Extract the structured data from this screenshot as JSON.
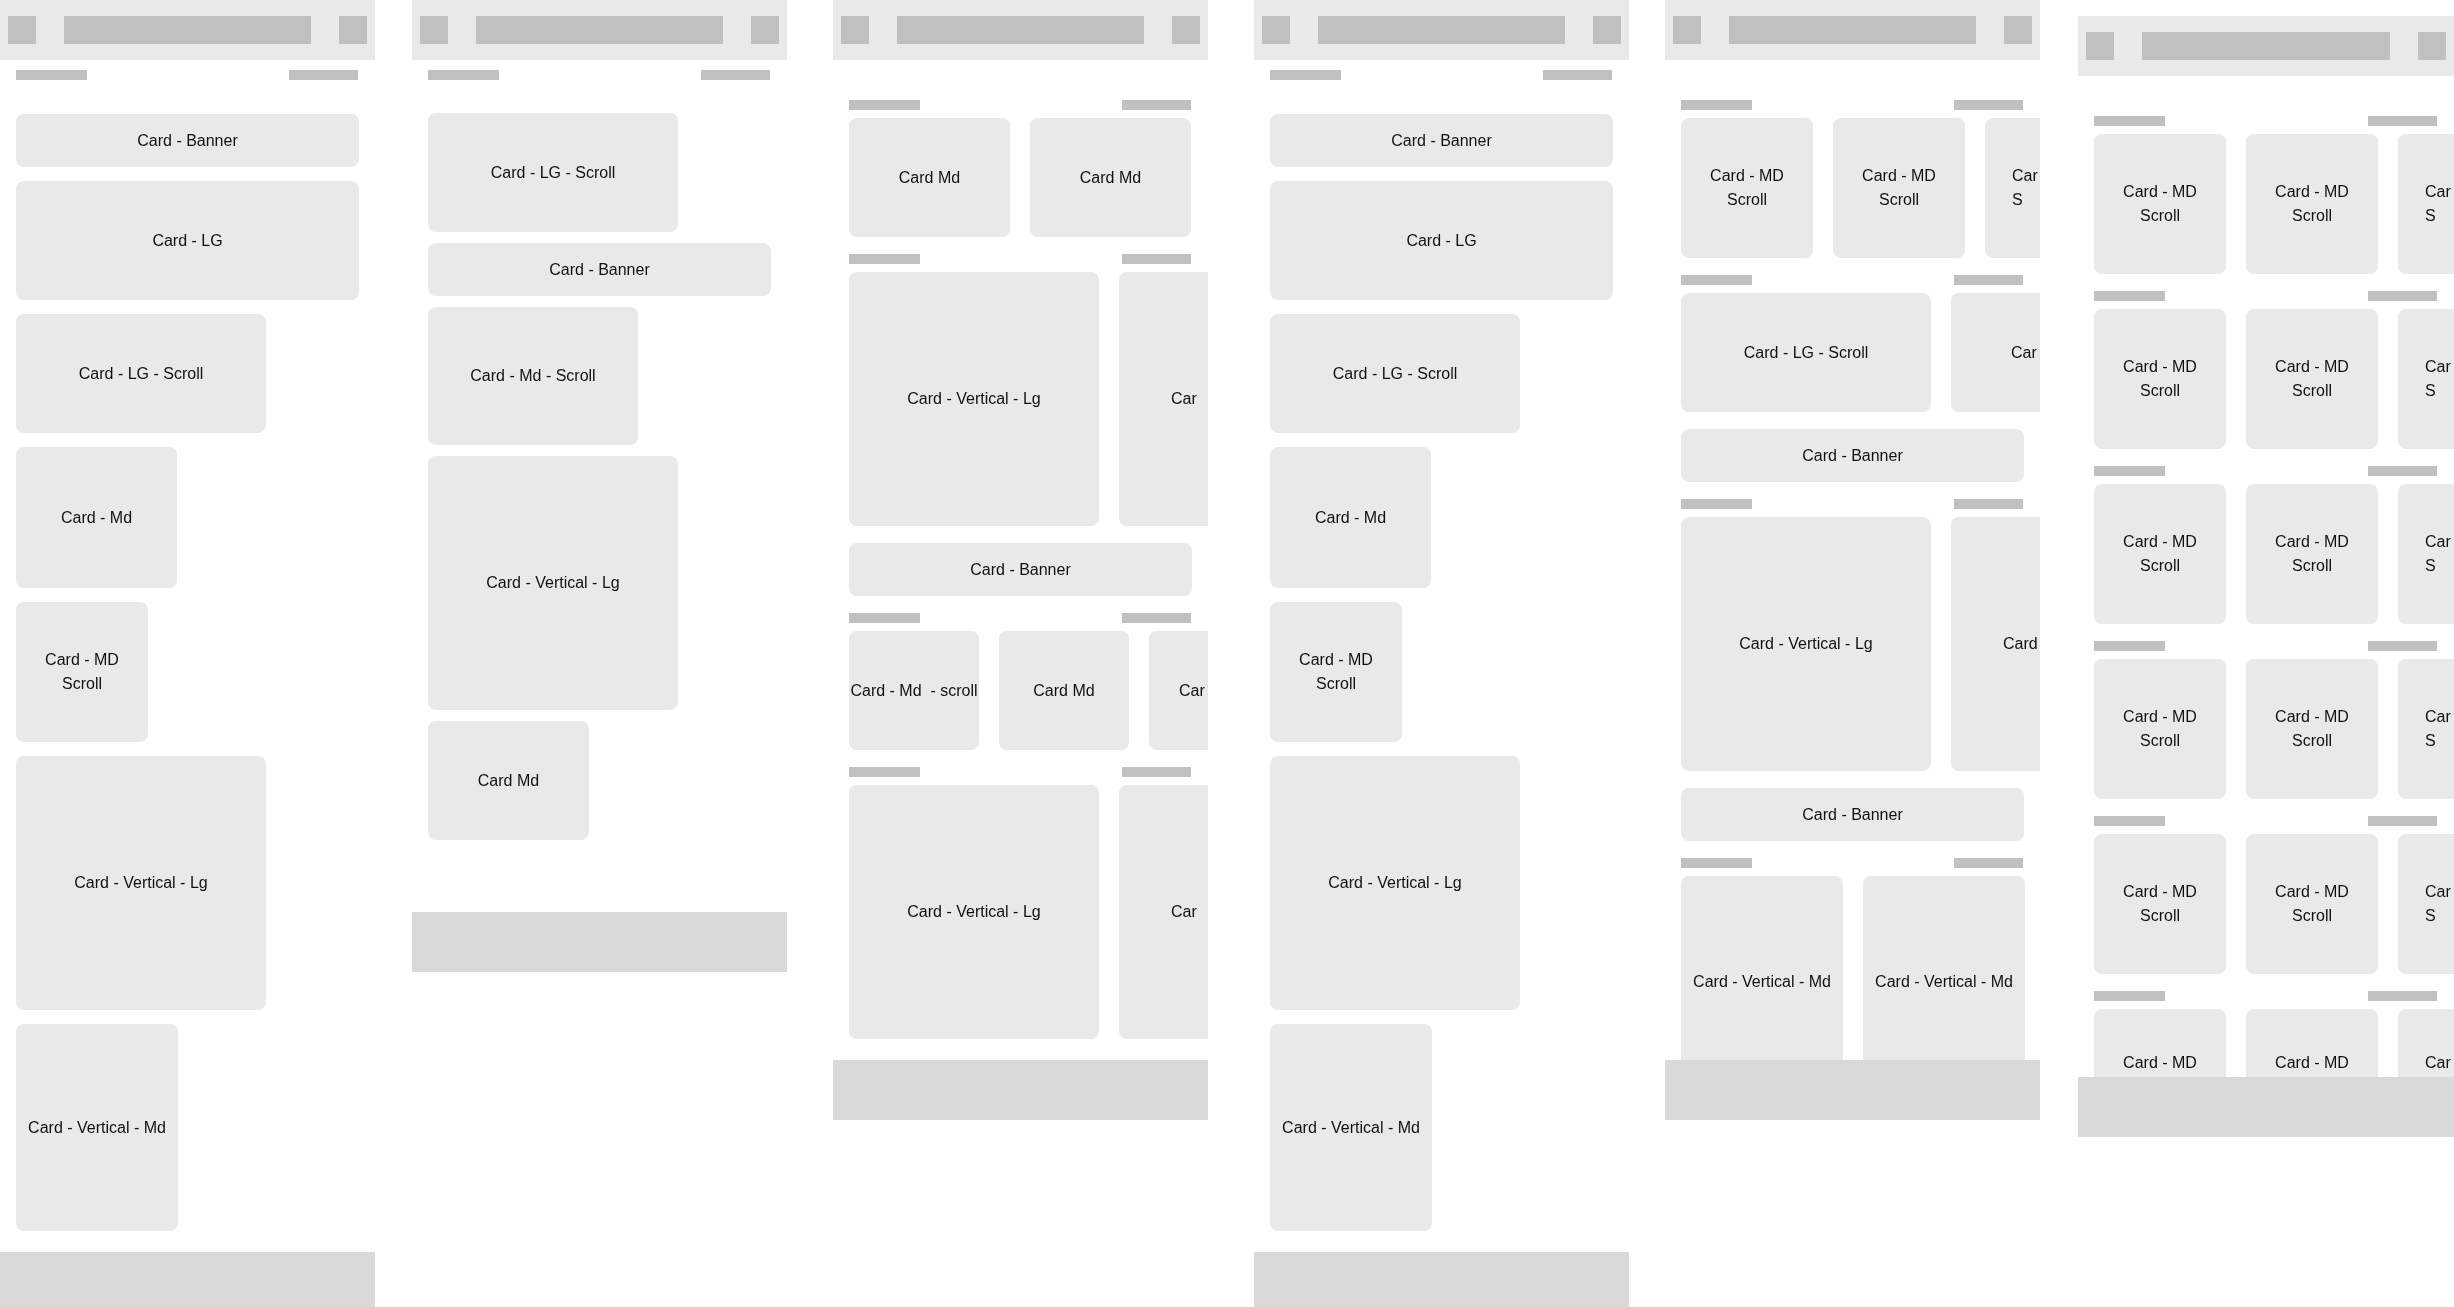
{
  "screens": [
    {
      "items": [
        {
          "kind": "header"
        },
        {
          "kind": "banner",
          "label": "Card - Banner"
        },
        {
          "kind": "large",
          "label": "Card - LG"
        },
        {
          "kind": "wide",
          "label": "Card - LG - Scroll"
        },
        {
          "kind": "medium",
          "label": "Card - Md"
        },
        {
          "kind": "narrow",
          "label": "Card - MD\nScroll"
        },
        {
          "kind": "tall",
          "label": "Card - Vertical - Lg"
        },
        {
          "kind": "portrait",
          "label": "Card - Vertical - Md"
        }
      ]
    },
    {
      "items": [
        {
          "kind": "header"
        },
        {
          "kind": "wide",
          "label": "Card - LG - Scroll"
        },
        {
          "kind": "banner",
          "label": "Card - Banner"
        },
        {
          "kind": "broad",
          "label": "Card - Md - Scroll"
        },
        {
          "kind": "tall",
          "label": "Card - Vertical - Lg"
        },
        {
          "kind": "compact",
          "label": "Card Md"
        }
      ]
    },
    {
      "items": [
        {
          "kind": "section",
          "overflow_right": false,
          "overflow_bottom": false,
          "cards": [
            {
              "kind": "compact",
              "label": "Card Md"
            },
            {
              "kind": "compact",
              "label": "Card Md"
            }
          ]
        },
        {
          "kind": "section",
          "overflow_right": true,
          "overflow_bottom": false,
          "cards": [
            {
              "kind": "tall",
              "label": "Card - Vertical - Lg"
            },
            {
              "kind": "tall",
              "label": "Car"
            }
          ]
        },
        {
          "kind": "banner",
          "label": "Card - Banner"
        },
        {
          "kind": "section",
          "overflow_right": true,
          "overflow_bottom": false,
          "cards": [
            {
              "kind": "small",
              "label": "Card - Md  - scroll"
            },
            {
              "kind": "small",
              "label": "Card Md"
            },
            {
              "kind": "small",
              "label": "Car"
            }
          ]
        },
        {
          "kind": "section",
          "overflow_right": true,
          "overflow_bottom": false,
          "cards": [
            {
              "kind": "tall",
              "label": "Card - Vertical - Lg"
            },
            {
              "kind": "tall",
              "label": "Car"
            }
          ]
        }
      ]
    },
    {
      "items": [
        {
          "kind": "header"
        },
        {
          "kind": "banner",
          "label": "Card - Banner"
        },
        {
          "kind": "large",
          "label": "Card - LG"
        },
        {
          "kind": "wide",
          "label": "Card - LG - Scroll"
        },
        {
          "kind": "medium",
          "label": "Card - Md"
        },
        {
          "kind": "narrow",
          "label": "Card - MD\nScroll"
        },
        {
          "kind": "tall",
          "label": "Card - Vertical - Lg"
        },
        {
          "kind": "portrait",
          "label": "Card - Vertical - Md"
        }
      ]
    },
    {
      "items": [
        {
          "kind": "section",
          "overflow_right": true,
          "overflow_bottom": false,
          "cards": [
            {
              "kind": "narrow",
              "label": "Card - MD\nScroll"
            },
            {
              "kind": "narrow",
              "label": "Card - MD\nScroll"
            },
            {
              "kind": "narrow",
              "label": "Car\nS"
            }
          ]
        },
        {
          "kind": "section",
          "overflow_right": true,
          "overflow_bottom": false,
          "cards": [
            {
              "kind": "wide",
              "label": "Card - LG - Scroll"
            },
            {
              "kind": "wide",
              "label": "Car"
            }
          ]
        },
        {
          "kind": "banner",
          "label": "Card - Banner"
        },
        {
          "kind": "section",
          "overflow_right": true,
          "overflow_bottom": false,
          "cards": [
            {
              "kind": "tall",
              "label": "Card - Vertical - Lg"
            },
            {
              "kind": "tall",
              "label": "Card"
            }
          ]
        },
        {
          "kind": "banner",
          "label": "Card - Banner"
        },
        {
          "kind": "section",
          "overflow_right": false,
          "overflow_bottom": true,
          "cards": [
            {
              "kind": "portrait",
              "label": "Card - Vertical - Md"
            },
            {
              "kind": "portrait",
              "label": "Card - Vertical - Md"
            }
          ]
        }
      ]
    },
    {
      "items": [
        {
          "kind": "section",
          "overflow_right": true,
          "overflow_bottom": false,
          "cards": [
            {
              "kind": "narrow",
              "label": "Card - MD\nScroll"
            },
            {
              "kind": "narrow",
              "label": "Card - MD\nScroll"
            },
            {
              "kind": "narrow",
              "label": "Car\nS"
            }
          ]
        },
        {
          "kind": "section",
          "overflow_right": true,
          "overflow_bottom": false,
          "cards": [
            {
              "kind": "narrow",
              "label": "Card - MD\nScroll"
            },
            {
              "kind": "narrow",
              "label": "Card - MD\nScroll"
            },
            {
              "kind": "narrow",
              "label": "Car\nS"
            }
          ]
        },
        {
          "kind": "section",
          "overflow_right": true,
          "overflow_bottom": false,
          "cards": [
            {
              "kind": "narrow",
              "label": "Card - MD\nScroll"
            },
            {
              "kind": "narrow",
              "label": "Card - MD\nScroll"
            },
            {
              "kind": "narrow",
              "label": "Car\nS"
            }
          ]
        },
        {
          "kind": "section",
          "overflow_right": true,
          "overflow_bottom": false,
          "cards": [
            {
              "kind": "narrow",
              "label": "Card - MD\nScroll"
            },
            {
              "kind": "narrow",
              "label": "Card - MD\nScroll"
            },
            {
              "kind": "narrow",
              "label": "Car\nS"
            }
          ]
        },
        {
          "kind": "section",
          "overflow_right": true,
          "overflow_bottom": false,
          "cards": [
            {
              "kind": "narrow",
              "label": "Card - MD\nScroll"
            },
            {
              "kind": "narrow",
              "label": "Card - MD\nScroll"
            },
            {
              "kind": "narrow",
              "label": "Car\nS"
            }
          ]
        },
        {
          "kind": "section",
          "overflow_right": true,
          "overflow_bottom": true,
          "cards": [
            {
              "kind": "narrow",
              "label": "Card - MD"
            },
            {
              "kind": "narrow",
              "label": "Card - MD"
            },
            {
              "kind": "narrow",
              "label": "Car"
            }
          ]
        }
      ]
    }
  ]
}
